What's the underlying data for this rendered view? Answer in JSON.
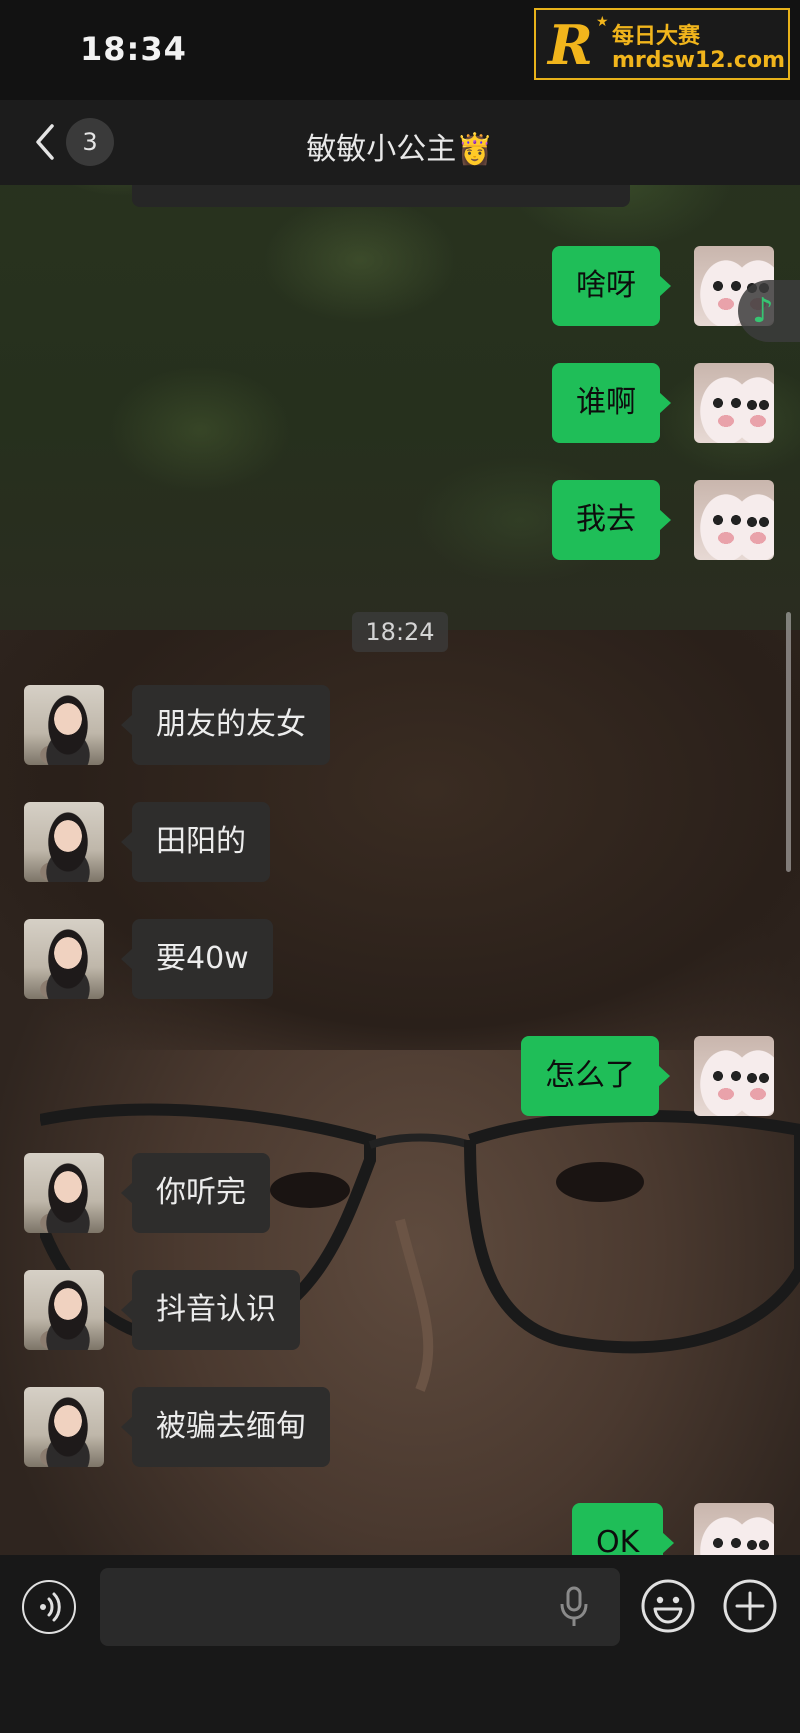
{
  "status_bar": {
    "time": "18:34"
  },
  "watermark": {
    "logo": "R",
    "title": "每日大赛",
    "url": "mrdsw12.com"
  },
  "header": {
    "unread_count": "3",
    "title": "敏敏小公主👸"
  },
  "timestamp": "18:24",
  "messages": [
    {
      "side": "out",
      "text": "啥呀"
    },
    {
      "side": "out",
      "text": "谁啊"
    },
    {
      "side": "out",
      "text": "我去"
    },
    {
      "side": "in",
      "text": "朋友的友女"
    },
    {
      "side": "in",
      "text": "田阳的"
    },
    {
      "side": "in",
      "text": "要40w"
    },
    {
      "side": "out",
      "text": "怎么了"
    },
    {
      "side": "in",
      "text": "你听完"
    },
    {
      "side": "in",
      "text": "抖音认识"
    },
    {
      "side": "in",
      "text": "被骗去缅甸"
    },
    {
      "side": "out",
      "text": "OK"
    }
  ],
  "input": {
    "value": "",
    "placeholder": ""
  },
  "colors": {
    "outgoing_bubble": "#1fbe58",
    "incoming_bubble": "#2e2d2c",
    "watermark_gold": "#f1b51c"
  },
  "icons": [
    "back-icon",
    "music-note-icon",
    "voice-icon",
    "microphone-icon",
    "emoji-icon",
    "plus-icon"
  ]
}
